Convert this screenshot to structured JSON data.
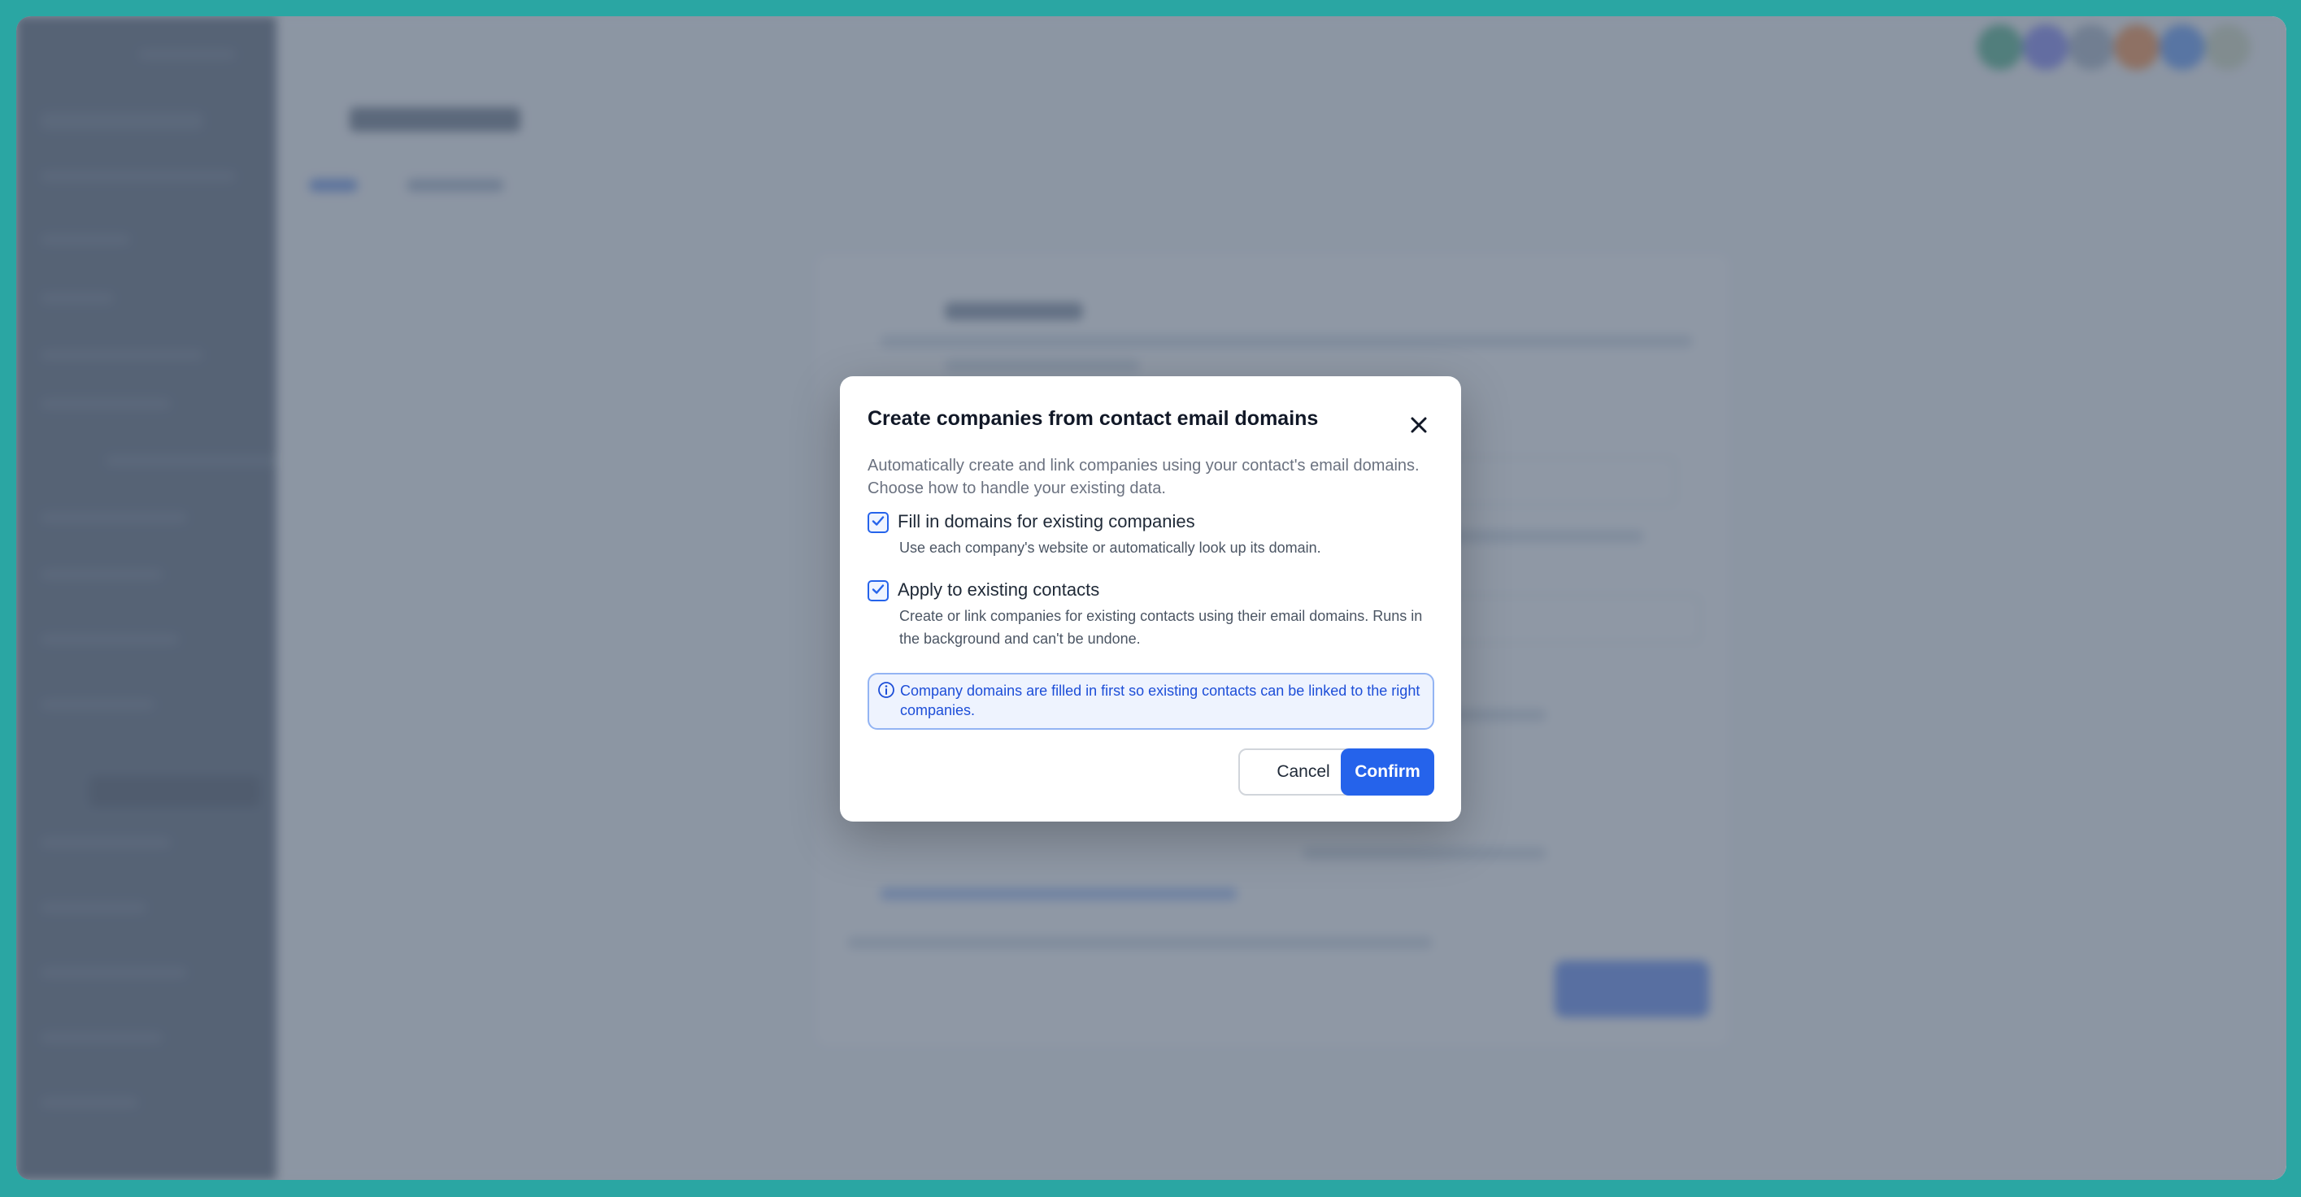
{
  "dialog": {
    "title": "Create companies from contact email domains",
    "description": "Automatically create and link companies using your contact's email domains. Choose how to handle your existing data.",
    "options": [
      {
        "label": "Fill in domains for existing companies",
        "help": "Use each company's website or automatically look up its domain.",
        "checked": true
      },
      {
        "label": "Apply to existing contacts",
        "help": "Create or link companies for existing contacts using their email domains. Runs in the background and can't be undone.",
        "checked": true
      }
    ],
    "info_note": "Company domains are filled in first so existing contacts can be linked to the right companies.",
    "cancel_label": "Cancel",
    "confirm_label": "Confirm"
  },
  "icons": {
    "close": "close-icon",
    "checkbox": "check-icon",
    "info": "info-icon"
  },
  "colors": {
    "accent": "#2563eb",
    "frame": "#2aa6a3",
    "sidebar": "#334155"
  }
}
